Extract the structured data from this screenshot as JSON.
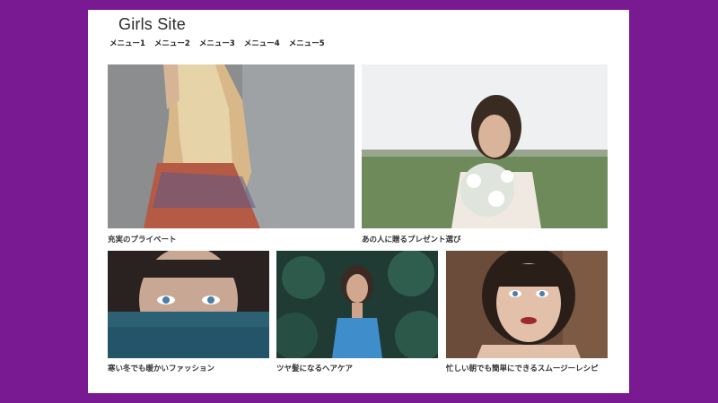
{
  "site": {
    "title": "Girls Site"
  },
  "nav": [
    "メニュー1",
    "メニュー2",
    "メニュー3",
    "メニュー4",
    "メニュー5"
  ],
  "cards": [
    {
      "caption": "充実のプライベート",
      "image": "woman-blonde-hair-plaid-shirt-photo"
    },
    {
      "caption": "あの人に贈るプレゼント選び",
      "image": "woman-holding-flowers-field-photo"
    },
    {
      "caption": "寒い冬でも暖かいファッション",
      "image": "woman-scarf-covering-face-photo"
    },
    {
      "caption": "ツヤ髪になるヘアケア",
      "image": "woman-blue-top-in-leaves-photo"
    },
    {
      "caption": "忙しい朝でも簡単にできるスムージーレシピ",
      "image": "woman-bangs-portrait-photo"
    }
  ],
  "colors": {
    "background": "#7a1a93",
    "page": "#ffffff",
    "text": "#333333"
  }
}
